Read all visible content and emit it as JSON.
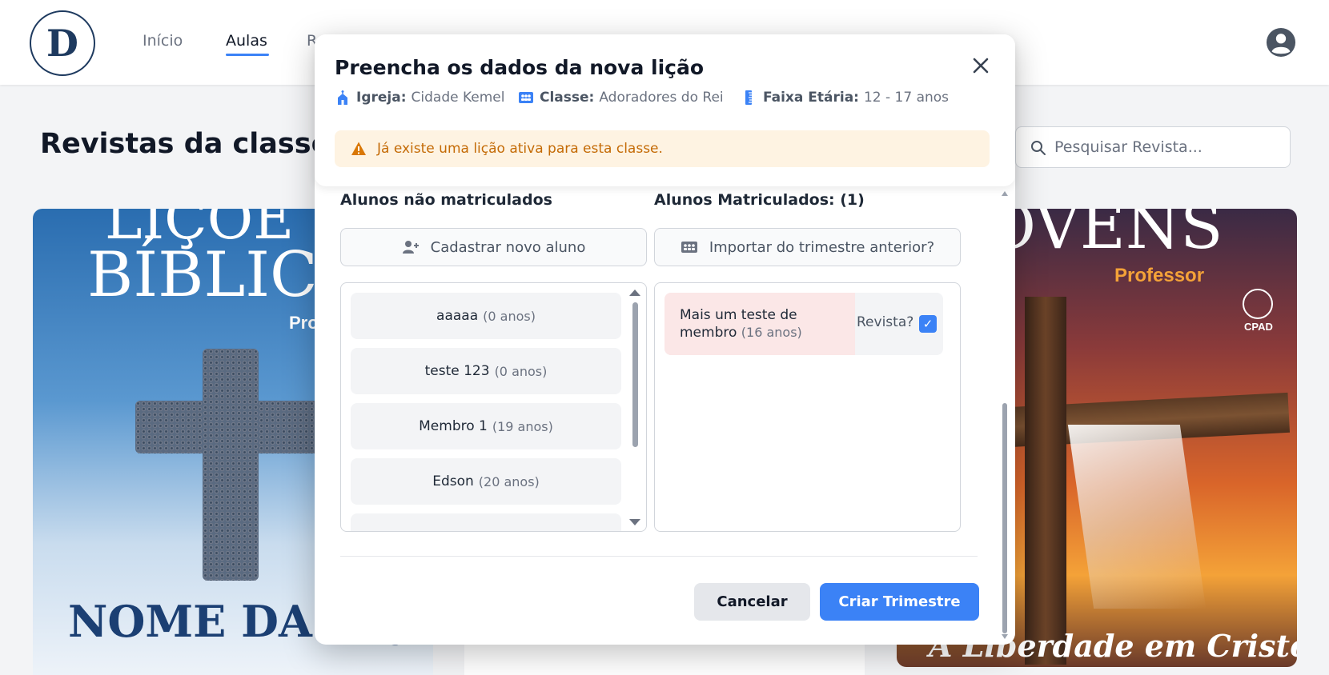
{
  "nav": {
    "logo_letter": "D",
    "links": [
      {
        "label": "Início"
      },
      {
        "label": "Aulas"
      },
      {
        "label": "R"
      }
    ]
  },
  "page": {
    "title": "Revistas da classe A",
    "search_placeholder": "Pesquisar Revista..."
  },
  "covers": {
    "card1": {
      "top_line1": "LIÇÕE",
      "top_line2": "BÍBLICA",
      "sub": "Pro",
      "bottom": "NOME DA LIÇ"
    },
    "card3": {
      "top": "OVENS",
      "sub": "Professor",
      "brand": "CPAD",
      "bottom": "A Liberdade em Cristo"
    }
  },
  "modal": {
    "title": "Preencha os dados da nova lição",
    "meta": {
      "igreja_label": "Igreja:",
      "igreja_value": "Cidade Kemel",
      "classe_label": "Classe:",
      "classe_value": "Adoradores do Rei",
      "faixa_label": "Faixa Etária:",
      "faixa_value": "12 - 17 anos"
    },
    "alert": "Já existe uma lição ativa para esta classe.",
    "left_column": {
      "title": "Alunos não matriculados",
      "button": "Cadastrar novo aluno",
      "students": [
        {
          "name": "aaaaa",
          "age": "(0 anos)"
        },
        {
          "name": "teste 123",
          "age": "(0 anos)"
        },
        {
          "name": "Membro 1",
          "age": "(19 anos)"
        },
        {
          "name": "Edson",
          "age": "(20 anos)"
        }
      ]
    },
    "right_column": {
      "title": "Alunos Matriculados: (1)",
      "button": "Importar do trimestre anterior?",
      "enrolled": [
        {
          "name": "Mais um teste de membro",
          "age": "(16 anos)",
          "revista_label": "Revista?",
          "revista_checked": true
        }
      ]
    },
    "actions": {
      "cancel": "Cancelar",
      "create": "Criar Trimestre"
    }
  },
  "colors": {
    "accent": "#3b82f6",
    "warning_text": "#c46a05",
    "warning_bg": "#fef3e2",
    "enrolled_bg": "#fbe7e7"
  }
}
